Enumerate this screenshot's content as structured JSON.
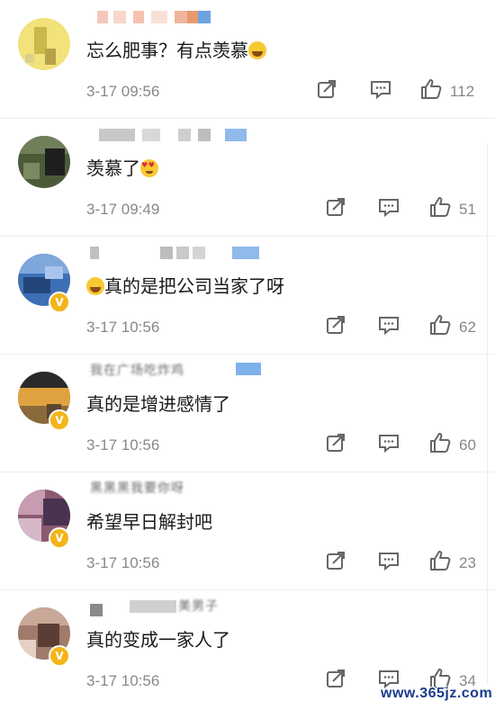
{
  "comments": [
    {
      "avatar_color": "#f1e27a",
      "text": "忘么肥事？有点羡慕",
      "emoji": "laugh",
      "time": "3-17 09:56",
      "likes": "112",
      "verified": false,
      "handle_text": ""
    },
    {
      "avatar_color": "#4d5a3a",
      "text": "羡慕了",
      "emoji": "heart",
      "time": "3-17 09:49",
      "likes": "51",
      "verified": false,
      "handle_text": ""
    },
    {
      "avatar_color": "#3d6fb5",
      "text": "真的是把公司当家了呀",
      "emoji_prefix": "laugh",
      "time": "3-17 10:56",
      "likes": "62",
      "verified": true,
      "handle_text": ""
    },
    {
      "avatar_color": "#8a6a3a",
      "text": "真的是增进感情了",
      "time": "3-17 10:56",
      "likes": "60",
      "verified": true,
      "handle_text": "我在广场吃炸鸡"
    },
    {
      "avatar_color": "#8a5a70",
      "text": "希望早日解封吧",
      "time": "3-17 10:56",
      "likes": "23",
      "verified": true,
      "handle_text": "黑黑黑我要你呀"
    },
    {
      "avatar_color": "#a07a6a",
      "text": "真的变成一家人了",
      "time": "3-17 10:56",
      "likes": "34",
      "verified": true,
      "handle_text": "美男子"
    }
  ],
  "icons": {
    "share": "share-icon",
    "reply": "comment-icon",
    "like": "thumbs-up-icon"
  },
  "colors": {
    "text": "#1a1a1a",
    "meta": "#888888",
    "verified_badge": "#f2b51a"
  },
  "watermark": "www.365jz.com"
}
